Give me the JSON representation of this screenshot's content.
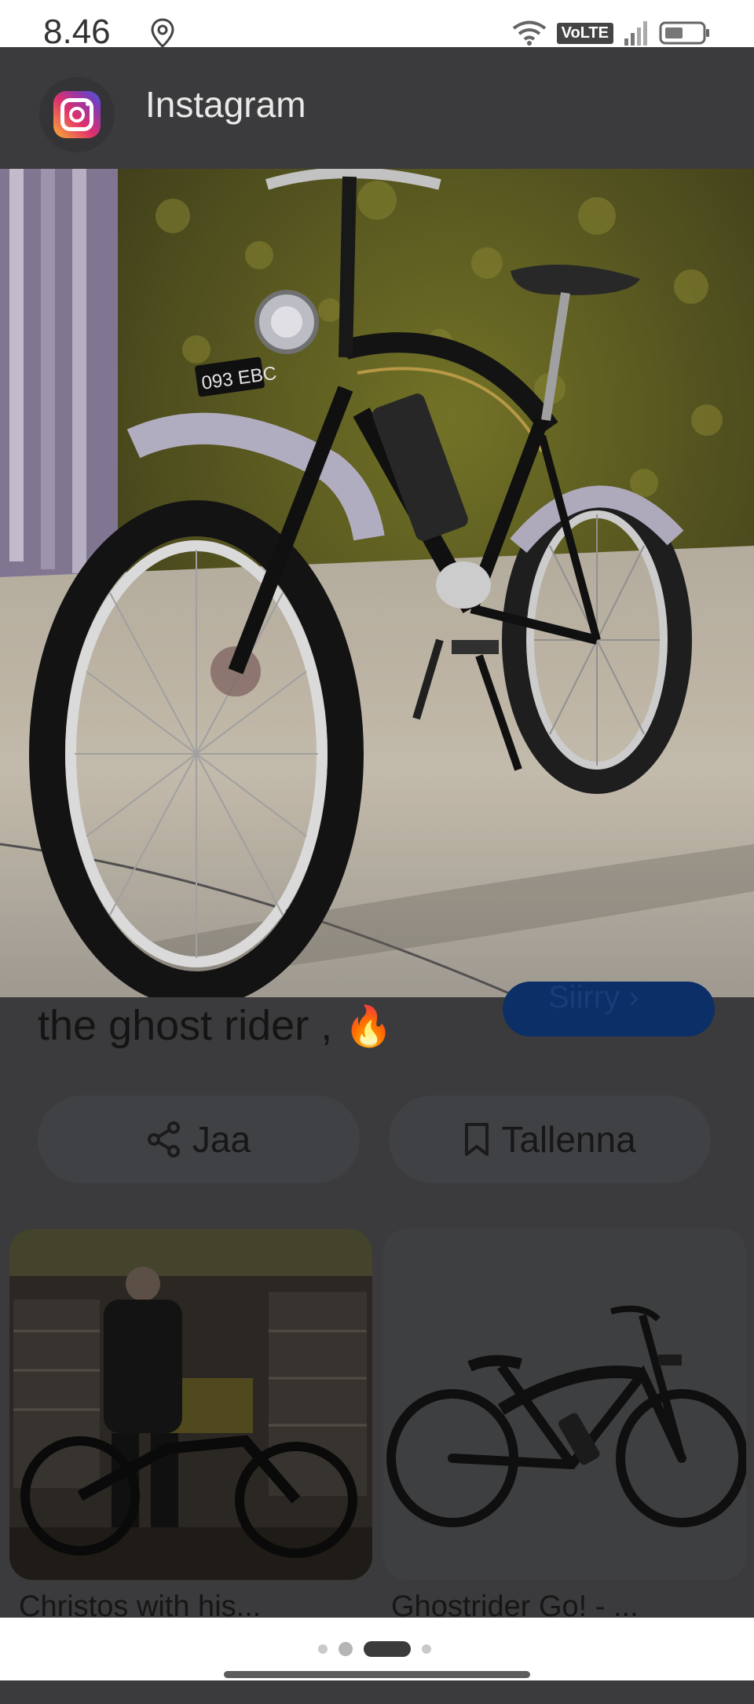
{
  "status_bar": {
    "time": "8.46",
    "network_label": "VoLTE",
    "icons": [
      "location-icon",
      "wifi-icon",
      "signal-icon",
      "battery-icon"
    ]
  },
  "header": {
    "app_name": "Instagram",
    "icon": "instagram-logo-icon"
  },
  "main_image": {
    "plate_text": "093 EBC"
  },
  "post": {
    "caption": "the ghost rider ,",
    "caption_emoji": "🔥",
    "visit_label": "Siirry ›"
  },
  "actions": {
    "share_label": "Jaa",
    "save_label": "Tallenna"
  },
  "related": [
    {
      "caption": "Christos with his..."
    },
    {
      "caption": "Ghostrider Go! - ..."
    }
  ],
  "pager": {
    "count": 4,
    "active": 2
  },
  "colors": {
    "scrim": "#3b3b3d",
    "visit_button": "#0b2f66"
  }
}
